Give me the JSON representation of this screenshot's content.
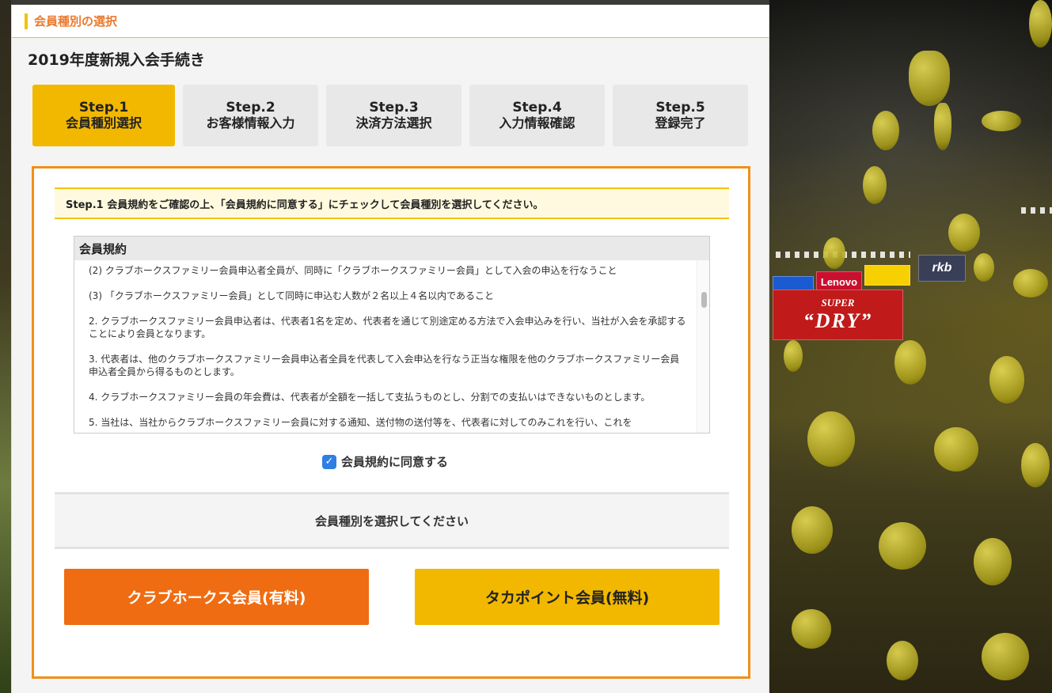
{
  "section_header": {
    "title": "会員種別の選択"
  },
  "page_title": "2019年度新規入会手続き",
  "steps": [
    {
      "num": "Step.1",
      "label": "会員種別選択",
      "active": true
    },
    {
      "num": "Step.2",
      "label": "お客様情報入力",
      "active": false
    },
    {
      "num": "Step.3",
      "label": "決済方法選択",
      "active": false
    },
    {
      "num": "Step.4",
      "label": "入力情報確認",
      "active": false
    },
    {
      "num": "Step.5",
      "label": "登録完了",
      "active": false
    }
  ],
  "instruction": "Step.1 会員規約をご確認の上、「会員規約に同意する」にチェックして会員種別を選択してください。",
  "terms": {
    "title": "会員規約",
    "paragraphs": [
      "(2) クラブホークスファミリー会員申込者全員が、同時に「クラブホークスファミリー会員」として入会の申込を行なうこと",
      "(3) 「クラブホークスファミリー会員」として同時に申込む人数が２名以上４名以内であること",
      "2. クラブホークスファミリー会員申込者は、代表者1名を定め、代表者を通じて別途定める方法で入会申込みを行い、当社が入会を承認することにより会員となります。",
      "3. 代表者は、他のクラブホークスファミリー会員申込者全員を代表して入会申込を行なう正当な権限を他のクラブホークスファミリー会員申込者全員から得るものとします。",
      "4. クラブホークスファミリー会員の年会費は、代表者が全額を一括して支払うものとし、分割での支払いはできないものとします。",
      "5. 当社は、当社からクラブホークスファミリー会員に対する通知、送付物の送付等を、代表者に対してのみこれを行い、これを"
    ]
  },
  "agree": {
    "label": "会員規約に同意する",
    "checked": true
  },
  "select_prompt": "会員種別を選択してください",
  "buttons": {
    "paid": "クラブホークス会員(有料)",
    "free": "タカポイント会員(無料)"
  },
  "colors": {
    "accent_yellow": "#f2b800",
    "accent_orange": "#ef6c12",
    "frame_orange": "#f0901a",
    "header_text": "#ea7a2e",
    "checkbox_blue": "#2f7ee3"
  },
  "background_signs": {
    "lenovo": "Lenovo",
    "super": "SUPER",
    "dry": "“DRY”",
    "rkb": "rkb"
  }
}
